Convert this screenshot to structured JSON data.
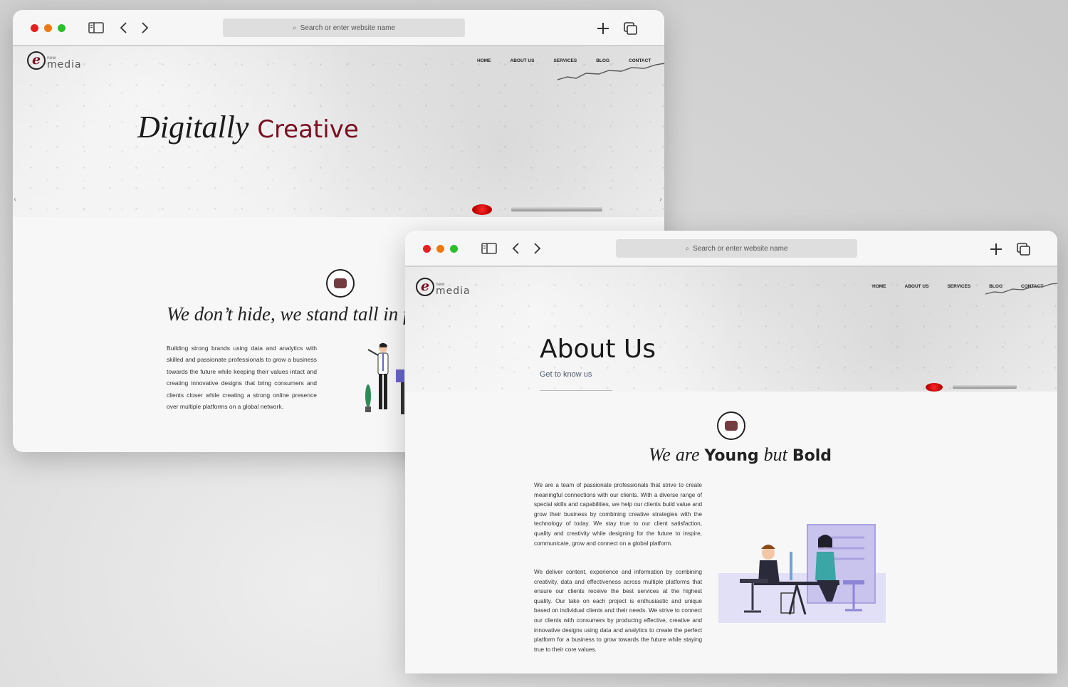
{
  "browser": {
    "url_placeholder": "Search or enter website name"
  },
  "site": {
    "logo_mark": "e",
    "logo_small": "new",
    "logo_text": "media",
    "nav": [
      "HOME",
      "ABOUT US",
      "SERVICES",
      "BLOG",
      "CONTACT"
    ]
  },
  "home": {
    "hero_word1": "Digitally",
    "hero_word2": "Creative",
    "tagline": "We don’t hide, we stand tall in front",
    "body": "Building strong brands using data and analytics with skilled and passionate professionals to grow a business towards the future while keeping their values intact and creating innovative designs that bring consumers and clients closer while creating a strong online presence over multiple platforms on a global network.",
    "slider_prev": "‹",
    "slider_next": "›"
  },
  "about": {
    "hero_title": "About Us",
    "hero_subtitle": "Get to know us",
    "tagline_we": "We",
    "tagline_are": "are",
    "tagline_young": "Young",
    "tagline_but": "but",
    "tagline_bold": "Bold",
    "body1": "We are a team of passionate professionals that strive to create meaningful connections with our clients. With a diverse range of special skills and capabilities, we help our clients build value and grow their business by combining creative strategies with the technology of today. We stay true to our client satisfaction, quality and creativity while designing for the future to inspire, communicate, grow and connect on a global platform.",
    "body2": "We deliver content, experience and information by combining creativity, data and effectiveness across multiple platforms that ensure our clients receive the best services at the highest quality. Our take on each project is enthusiastic and unique based on individual clients and their needs. We strive to connect our clients with consumers by producing effective, creative and innovative designs using data and analytics to create the perfect platform for a business to grow towards the future while staying true to their core values."
  },
  "colors": {
    "accent": "#7a1020",
    "traffic_red": "#e22020",
    "traffic_orange": "#ef7a12",
    "traffic_green": "#2bbf2b",
    "illustration_lavender": "#c9c4ee"
  }
}
